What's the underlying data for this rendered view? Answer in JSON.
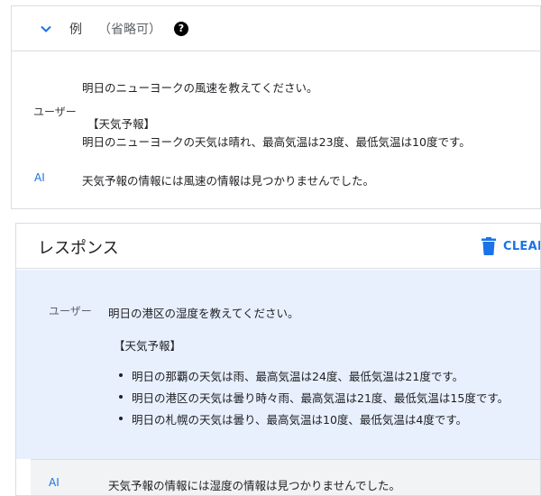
{
  "example": {
    "title": "例",
    "optional": "（省略可）",
    "help_icon": "?",
    "user_role": "ユーザー",
    "user_question": "明日のニューヨークの風速を教えてください。",
    "user_context_header": "【天気予報】",
    "user_context_body": "明日のニューヨークの天気は晴れ、最高気温は23度、最低気温は10度です。",
    "ai_role": "AI",
    "ai_answer": "天気予報の情報には風速の情報は見つかりませんでした。"
  },
  "response": {
    "title": "レスポンス",
    "clear_label": "CLEAR",
    "user_role": "ユーザー",
    "user_question": "明日の港区の湿度を教えてください。",
    "context_header": "【天気予報】",
    "bullets": [
      "明日の那覇の天気は雨、最高気温は24度、最低気温は21度です。",
      "明日の港区の天気は曇り時々雨、最高気温は21度、最低気温は15度です。",
      "明日の札幌の天気は曇り、最高気温は10度、最低気温は4度です。"
    ],
    "ai_role": "AI",
    "ai_answer": "天気予報の情報には湿度の情報は見つかりませんでした。"
  },
  "colors": {
    "accent": "#1a73e8",
    "user_background": "#e8f0fe",
    "ai_background": "#f1f3f4",
    "border": "#dadce0"
  },
  "icons": {
    "collapse": "chevron-down-icon",
    "help": "help-icon",
    "clear": "trash-icon"
  }
}
